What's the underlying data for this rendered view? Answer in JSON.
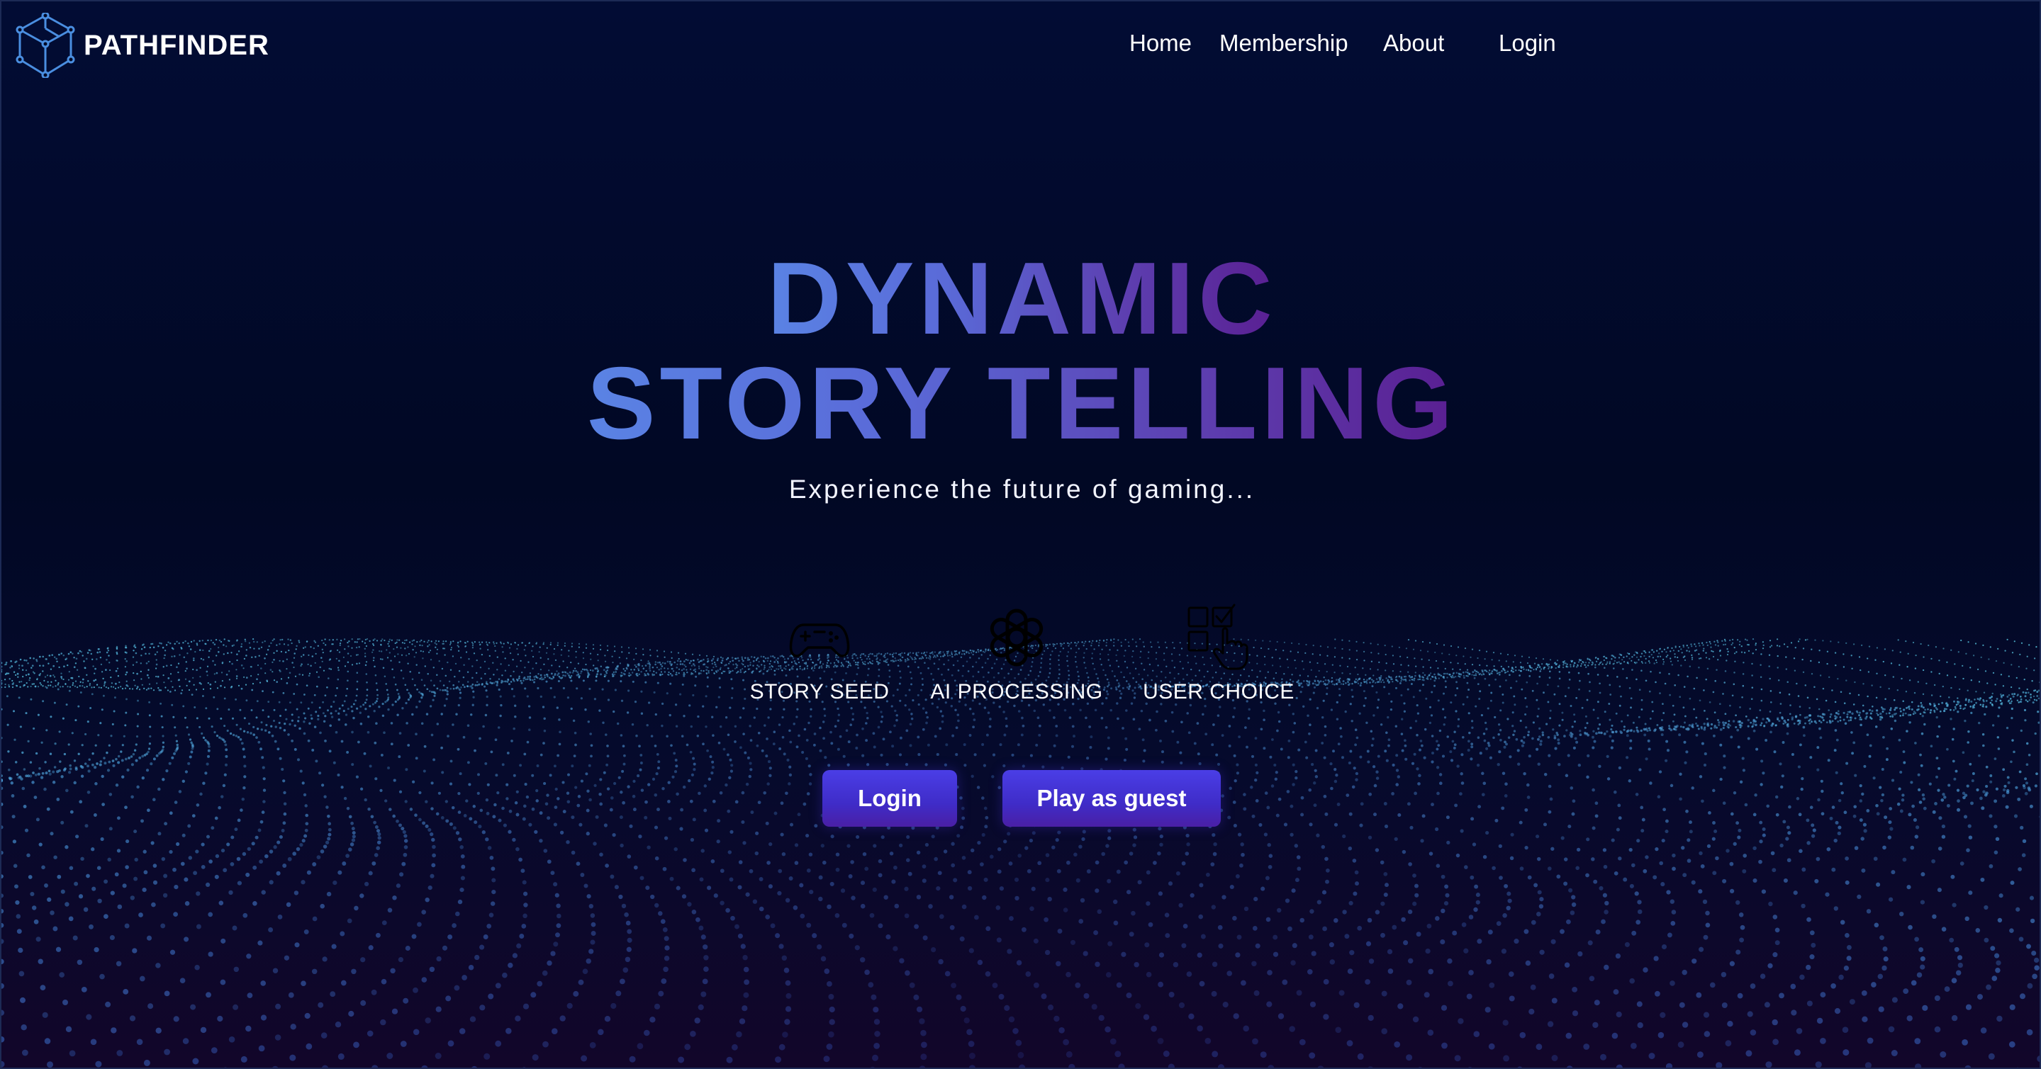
{
  "header": {
    "brand": "PATHFINDER",
    "logo_icon": "cube-network-icon",
    "nav": [
      {
        "label": "Home"
      },
      {
        "label": "Membership"
      },
      {
        "label": "About"
      },
      {
        "label": "Login"
      }
    ]
  },
  "hero": {
    "title_line1": "DYNAMIC",
    "title_line2": "STORY TELLING",
    "subtitle": "Experience the future of gaming..."
  },
  "features": [
    {
      "label": "STORY SEED",
      "icon": "gamepad-icon"
    },
    {
      "label": "AI PROCESSING",
      "icon": "openai-knot-icon"
    },
    {
      "label": "USER CHOICE",
      "icon": "checklist-pointer-icon"
    }
  ],
  "actions": {
    "login_label": "Login",
    "guest_label": "Play as guest"
  },
  "colors": {
    "background": "#020a2e",
    "title_gradient_start": "#5a83e4",
    "title_gradient_end": "#5a1f92",
    "button": "#4034d6",
    "logo_stroke": "#4a8ee0",
    "dots": "#3f78c8"
  }
}
